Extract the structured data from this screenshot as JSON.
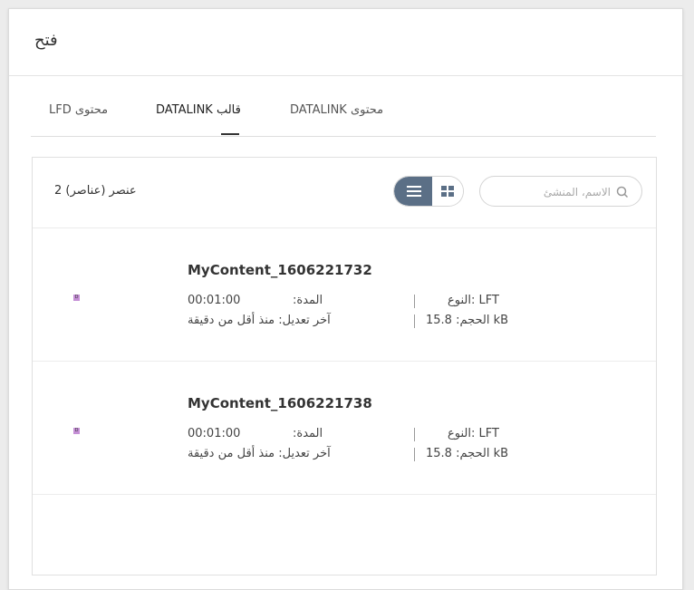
{
  "dialog": {
    "title": "فتح"
  },
  "tabs": [
    {
      "label": "LFD محتوى"
    },
    {
      "label": "DATALINK قالب"
    },
    {
      "label": "DATALINK محتوى"
    }
  ],
  "active_tab": "DATALINK قالب",
  "toolbar": {
    "item_count": "عنصر (عناصر) 2",
    "search_placeholder": "الاسم، المنشئ",
    "view_mode": "list"
  },
  "items": [
    {
      "name": "MyContent_1606221732",
      "duration_label": "المدة:",
      "duration_value": "00:01:00",
      "modified": "آخر تعديل: منذ أقل من دقيقة",
      "type": "LFT :النوع",
      "size": "kB الحجم: 15.8"
    },
    {
      "name": "MyContent_1606221738",
      "duration_label": "المدة:",
      "duration_value": "00:01:00",
      "modified": "آخر تعديل: منذ أقل من دقيقة",
      "type": "LFT :النوع",
      "size": "kB الحجم: 15.8"
    }
  ],
  "colors": {
    "accent": "#5b6f86",
    "thumbnail": "#c58fd6"
  }
}
